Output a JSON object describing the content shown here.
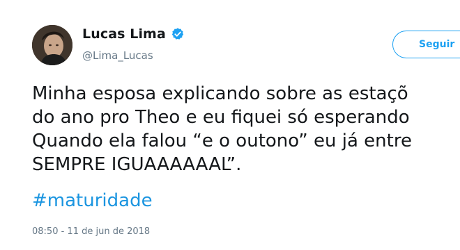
{
  "tweet": {
    "author": {
      "display_name": "Lucas Lima",
      "handle": "@Lima_Lucas",
      "verified": true,
      "avatar_icon": "profile-photo"
    },
    "follow_button_label": "Seguir",
    "text_lines": [
      "Minha esposa explicando sobre as estaçõ",
      "do ano pro Theo e eu fiquei só esperando",
      "Quando ela falou “e o outono” eu já entre",
      "SEMPRE IGUAAAAAAL”."
    ],
    "hashtag": "#maturidade",
    "timestamp": "08:50 - 11 de jun de 2018"
  },
  "colors": {
    "accent": "#1da1f2",
    "hashtag": "#1b95e0",
    "secondary_text": "#657786",
    "primary_text": "#14171a"
  }
}
